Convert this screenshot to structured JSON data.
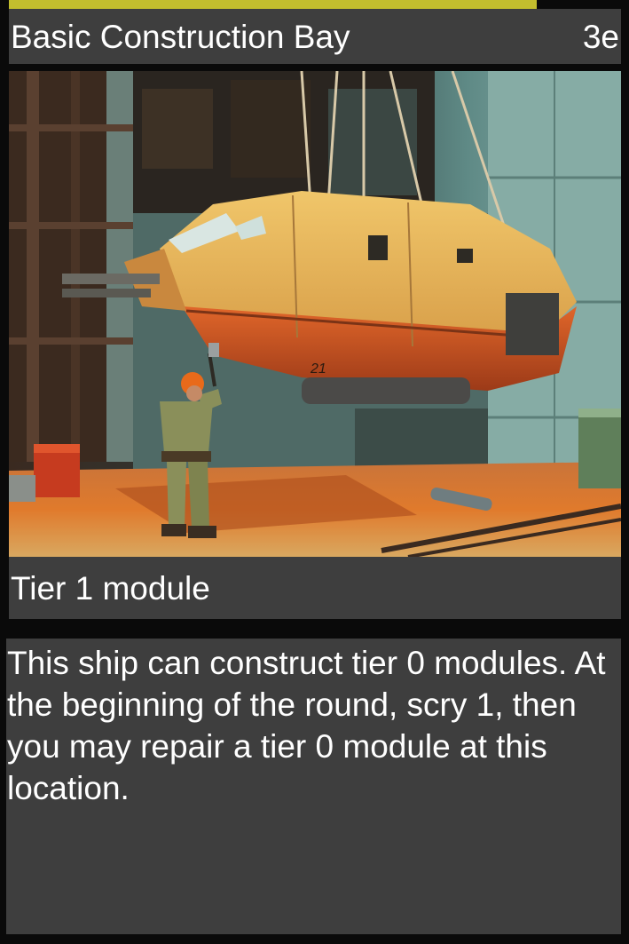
{
  "card": {
    "title": "Basic Construction Bay",
    "cost": "3e",
    "type_line": "Tier 1 module",
    "rules_text": "This ship can construct tier 0 modules. At the beginning of the round, scry 1, then you may repair a tier 0 module at this location.",
    "art": {
      "description_icon": "hangar-ship-illustration",
      "hull_number": "21"
    }
  },
  "colors": {
    "accent": "#c3be2e",
    "panel": "#3e3e3e",
    "background": "#0a0a0a",
    "text": "#ffffff"
  }
}
